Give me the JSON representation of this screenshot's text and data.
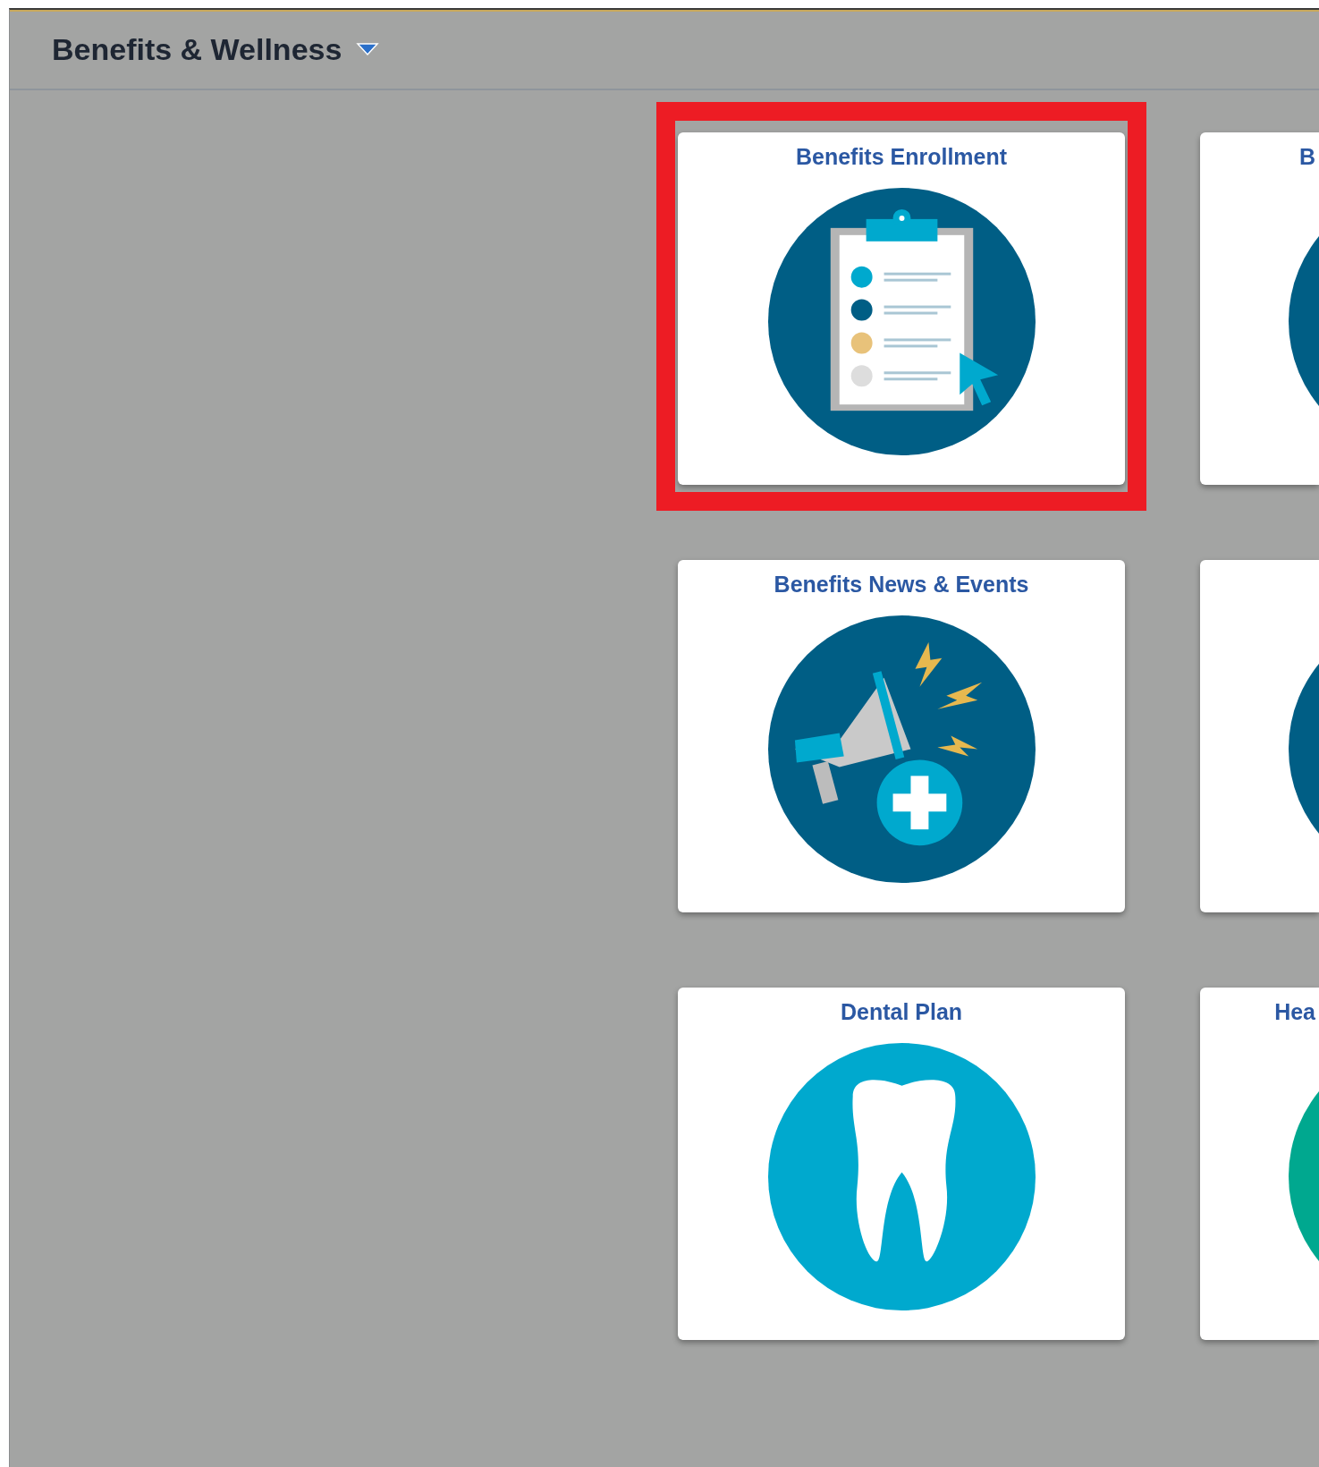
{
  "header": {
    "title": "Benefits & Wellness",
    "dropdown": true
  },
  "tiles": [
    {
      "kind": "clipboard",
      "title": "Benefits Enrollment",
      "color": "#005e85",
      "highlighted": true
    },
    {
      "kind": "partial",
      "title": "B",
      "color": "#005e85",
      "highlighted": false
    },
    {
      "kind": "megaphone",
      "title": "Benefits News & Events",
      "color": "#005e85",
      "highlighted": false
    },
    {
      "kind": "partial",
      "color": "#005e85",
      "highlighted": false
    },
    {
      "kind": "tooth",
      "title": "Dental Plan",
      "color": "#00a9ce",
      "highlighted": false
    },
    {
      "kind": "partial",
      "title": "Hea",
      "color": "#00a88f",
      "highlighted": false
    }
  ]
}
